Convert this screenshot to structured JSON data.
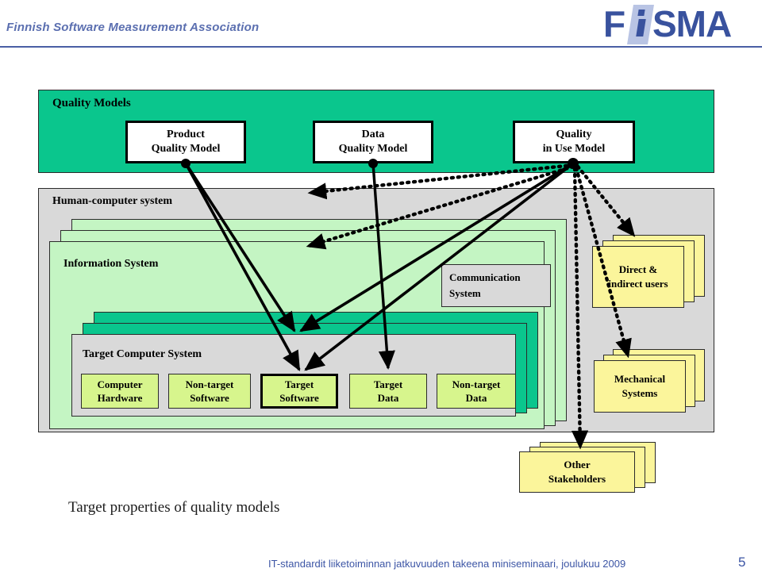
{
  "header": {
    "association_name": "Finnish Software Measurement Association",
    "logo": {
      "f_text": "F",
      "sma_text": "SMA",
      "accent_color": "#39529e",
      "panel_color": "#b9c4e4"
    }
  },
  "diagram": {
    "quality_models": {
      "title": "Quality Models",
      "band_color": "#0ac68d",
      "cards": [
        {
          "id": "product",
          "line1": "Product",
          "line2": "Quality Model"
        },
        {
          "id": "data",
          "line1": "Data",
          "line2": "Quality Model"
        },
        {
          "id": "inuse",
          "line1": "Quality",
          "line2": "in Use Model"
        }
      ]
    },
    "human_computer_system": {
      "title": "Human-computer system",
      "fill_color": "#d9d9d9"
    },
    "information_system": {
      "title": "Information System",
      "fill_color": "#c4f5c3",
      "stack_count": 3
    },
    "communication_system": {
      "line1": "Communication",
      "line2": "System",
      "fill_color": "#d9d9d9"
    },
    "target_computer_system": {
      "title": "Target Computer System",
      "stack_color": "#0ac68d",
      "fill_color": "#d9d9d9",
      "cell_color": "#d7f58d",
      "cells": [
        {
          "id": "computer-hardware",
          "line1": "Computer",
          "line2": "Hardware",
          "emphasized": false
        },
        {
          "id": "non-target-software",
          "line1": "Non-target",
          "line2": "Software",
          "emphasized": false
        },
        {
          "id": "target-software",
          "line1": "Target",
          "line2": "Software",
          "emphasized": true
        },
        {
          "id": "target-data",
          "line1": "Target",
          "line2": "Data",
          "emphasized": false
        },
        {
          "id": "non-target-data",
          "line1": "Non-target",
          "line2": "Data",
          "emphasized": false
        }
      ]
    },
    "actors": [
      {
        "id": "direct-indirect-users",
        "line1": "Direct &",
        "line2": "indirect users",
        "fill_color": "#fbf59b"
      },
      {
        "id": "mechanical-systems",
        "line1": "Mechanical",
        "line2": "Systems",
        "fill_color": "#fbf59b"
      },
      {
        "id": "other-stakeholders",
        "line1": "Other",
        "line2": "Stakeholders",
        "fill_color": "#fbf59b"
      }
    ],
    "caption": "Target properties of quality models",
    "connectors": {
      "solid_description": "Product and Data quality models point to Target Software and Target Data",
      "dotted_description": "Quality in Use model points to Human-computer system, Information System, users, mechanical systems and other stakeholders"
    }
  },
  "footer": {
    "text": "IT-standardit liiketoiminnan jatkuvuuden takeena miniseminaari, joulukuu 2009",
    "page_number": "5",
    "color": "#3c55a5"
  }
}
